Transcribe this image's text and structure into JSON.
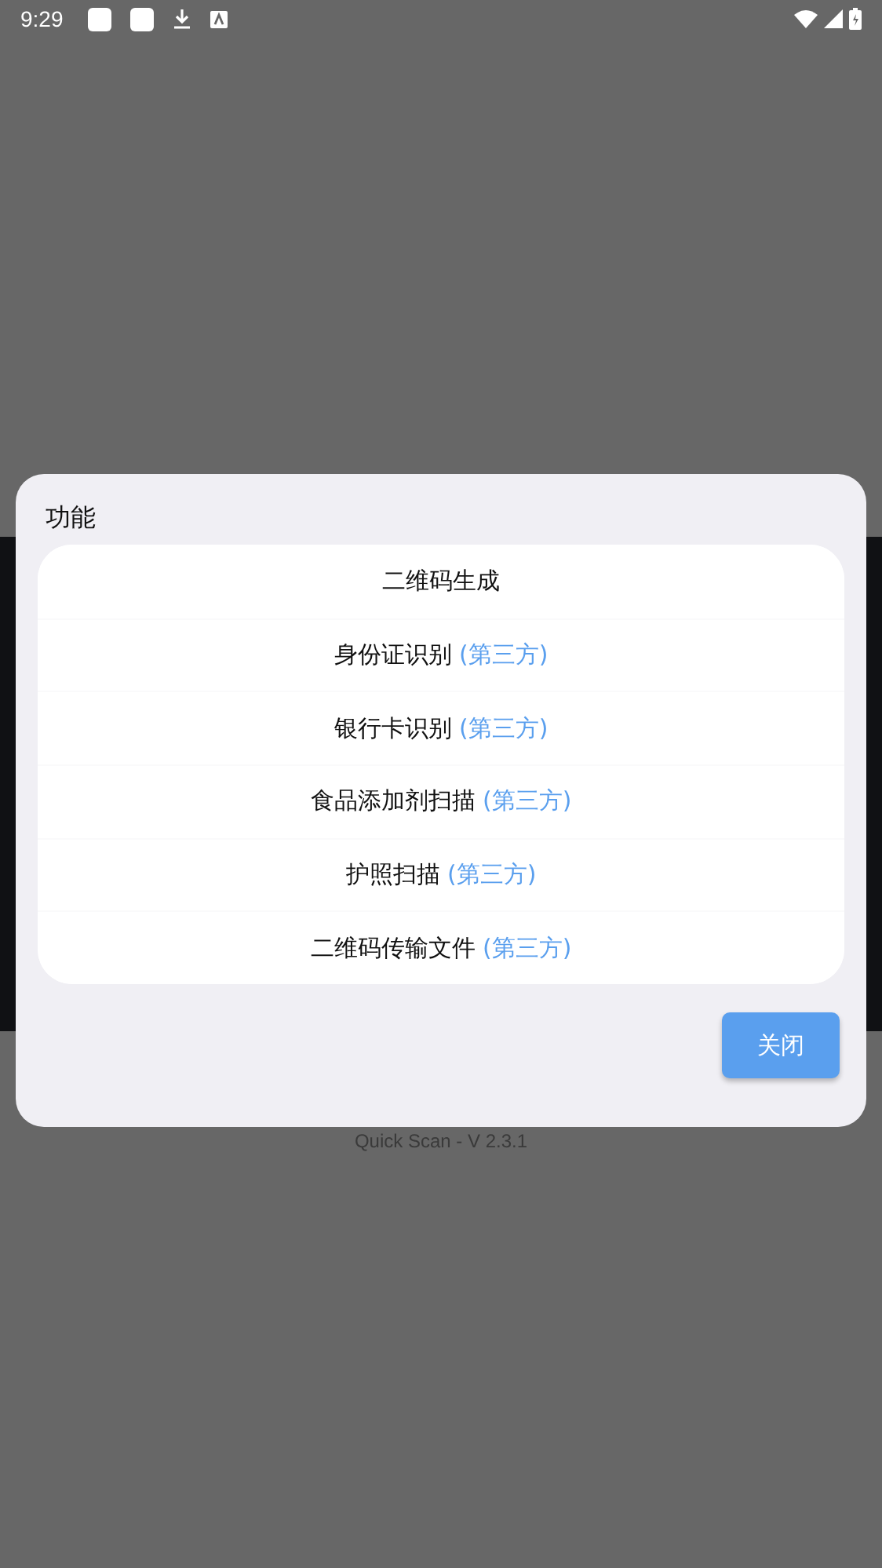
{
  "status_bar": {
    "time": "9:29"
  },
  "background": {
    "footer": "Quick Scan - V 2.3.1"
  },
  "dialog": {
    "title": "功能",
    "items": [
      {
        "label": "二维码生成"
      },
      {
        "label": "身份证识别",
        "suffix": "(第三方)"
      },
      {
        "label": "银行卡识别",
        "suffix": "(第三方)"
      },
      {
        "label": "食品添加剂扫描",
        "suffix": "(第三方)"
      },
      {
        "label": "护照扫描",
        "suffix": "(第三方)"
      },
      {
        "label": "二维码传输文件",
        "suffix": "(第三方)"
      }
    ],
    "buttons": [
      "关闭"
    ]
  }
}
